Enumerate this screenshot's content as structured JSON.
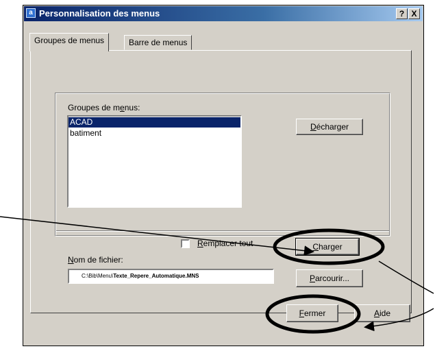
{
  "window": {
    "title": "Personnalisation des menus",
    "help_btn": "?",
    "close_btn": "X"
  },
  "tabs": [
    {
      "label": "Groupes de menus",
      "active": true
    },
    {
      "label": "Barre de menus",
      "active": false
    }
  ],
  "menu_groups": {
    "label_pre": "Groupes de m",
    "label_ul": "e",
    "label_post": "nus:",
    "items": [
      {
        "label": "ACAD",
        "selected": true
      },
      {
        "label": "batiment",
        "selected": false
      }
    ]
  },
  "buttons": {
    "decharger_ul": "D",
    "decharger_rest": "écharger",
    "charger_ul": "C",
    "charger_rest": "harger",
    "parcourir_ul": "P",
    "parcourir_rest": "arcourir...",
    "fermer_ul": "F",
    "fermer_rest": "ermer",
    "aide_ul": "A",
    "aide_rest": "ide"
  },
  "replace_all": {
    "label_ul": "R",
    "label_rest": "emplacer tout",
    "checked": false
  },
  "filename": {
    "label_ul": "N",
    "label_rest": "om de fichier:",
    "value_prefix": "C:\\Bib\\Menu\\",
    "value_bold": "Texte_Repere_Automatique.MNS"
  },
  "colors": {
    "titlebar": "#0a246a",
    "dialog_bg": "#d4d0c8",
    "selection": "#0a246a",
    "annotation": "#000000"
  }
}
